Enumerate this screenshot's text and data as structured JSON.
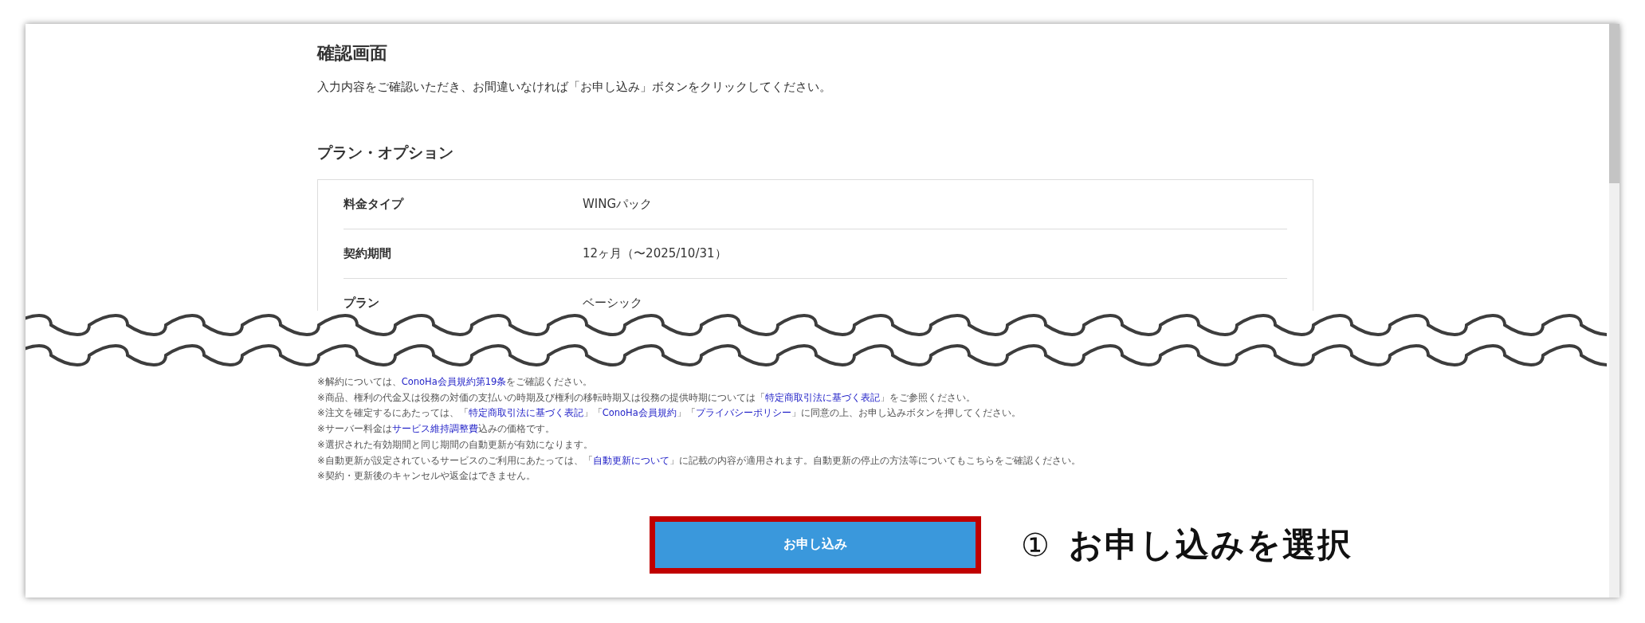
{
  "page": {
    "title": "確認画面",
    "intro": "入力内容をご確認いただき、お間違いなければ「お申し込み」ボタンをクリックしてください。",
    "section_title": "プラン・オプション",
    "rows": [
      {
        "label": "料金タイプ",
        "value": "WINGパック"
      },
      {
        "label": "契約期間",
        "value": "12ヶ月（〜2025/10/31）"
      },
      {
        "label": "プラン",
        "value": "ベーシック"
      }
    ],
    "notes": [
      {
        "parts": [
          {
            "text": "※解約については、",
            "link": false
          },
          {
            "text": "ConoHa会員規約第19条",
            "link": true
          },
          {
            "text": "をご確認ください。",
            "link": false
          }
        ]
      },
      {
        "parts": [
          {
            "text": "※商品、権利の代金又は役務の対価の支払いの時期及び権利の移転時期又は役務の提供時期については「",
            "link": false
          },
          {
            "text": "特定商取引法に基づく表記",
            "link": true
          },
          {
            "text": "」をご参照ください。",
            "link": false
          }
        ]
      },
      {
        "parts": [
          {
            "text": "※注文を確定するにあたっては、「",
            "link": false
          },
          {
            "text": "特定商取引法に基づく表記",
            "link": true
          },
          {
            "text": "」「",
            "link": false
          },
          {
            "text": "ConoHa会員規約",
            "link": true
          },
          {
            "text": "」「",
            "link": false
          },
          {
            "text": "プライバシーポリシー",
            "link": true
          },
          {
            "text": "」に同意の上、お申し込みボタンを押してください。",
            "link": false
          }
        ]
      },
      {
        "parts": [
          {
            "text": "※サーバー料金は",
            "link": false
          },
          {
            "text": "サービス維持調整費",
            "link": true
          },
          {
            "text": "込みの価格です。",
            "link": false
          }
        ]
      },
      {
        "parts": [
          {
            "text": "※選択された有効期間と同じ期間の自動更新が有効になります。",
            "link": false
          }
        ]
      },
      {
        "parts": [
          {
            "text": "※自動更新が設定されているサービスのご利用にあたっては、「",
            "link": false
          },
          {
            "text": "自動更新について",
            "link": true
          },
          {
            "text": "」に記載の内容が適用されます。自動更新の停止の方法等についてもこちらをご確認ください。",
            "link": false
          }
        ]
      },
      {
        "parts": [
          {
            "text": "※契約・更新後のキャンセルや返金はできません。",
            "link": false
          }
        ]
      }
    ],
    "submit_button": "お申し込み"
  },
  "annotation": {
    "marker": "①",
    "text": "お申し込みを選択"
  }
}
